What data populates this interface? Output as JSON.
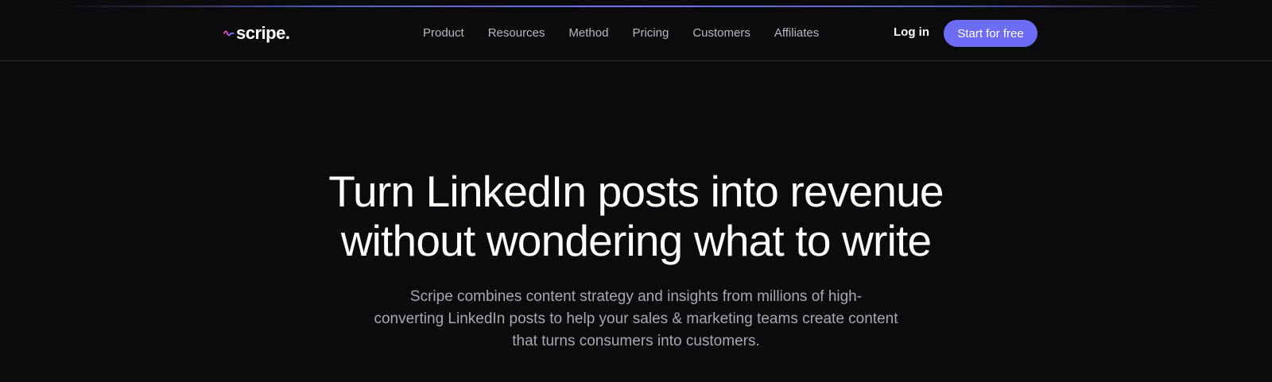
{
  "brand": {
    "name": "scripe.",
    "logo_icon": "soundwave-icon",
    "accent_color": "#6d6cf7"
  },
  "nav": {
    "links": [
      {
        "label": "Product"
      },
      {
        "label": "Resources"
      },
      {
        "label": "Method"
      },
      {
        "label": "Pricing"
      },
      {
        "label": "Customers"
      },
      {
        "label": "Affiliates"
      }
    ],
    "login_label": "Log in",
    "cta_label": "Start for free"
  },
  "hero": {
    "title_line1": "Turn LinkedIn posts into revenue",
    "title_line2": "without wondering what to write",
    "subtitle_line1": "Scripe combines content strategy and insights from millions of high-",
    "subtitle_line2": "converting LinkedIn posts to help your sales & marketing teams create content",
    "subtitle_line3": "that turns consumers into customers."
  }
}
